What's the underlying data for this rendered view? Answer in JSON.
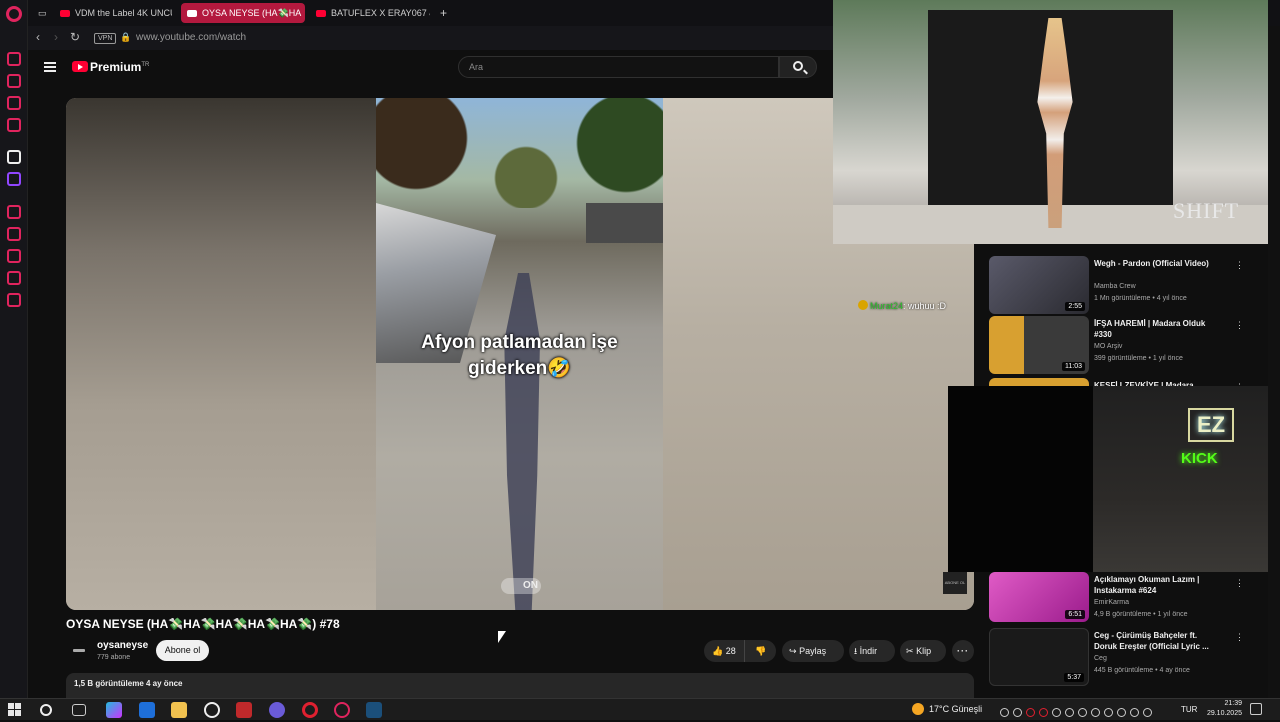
{
  "browser": {
    "tabs": [
      {
        "label": "VDM the Label 4K UNCUT"
      },
      {
        "label": "OYSA NEYSE (HA💸HA"
      },
      {
        "label": "BATUFLEX X ERAY067 &"
      }
    ],
    "vpn_label": "VPN",
    "url": "www.youtube.com/watch"
  },
  "youtube": {
    "brand": "Premium",
    "brand_sup": "TR",
    "search_placeholder": "Ara"
  },
  "video": {
    "caption": "Afyon patlamadan işe giderken🤣",
    "badge_text": "ON",
    "watermark": "ABONE OL",
    "title": "OYSA NEYSE (HA💸HA💸HA💸HA💸HA💸) #78",
    "channel": "oysaneyse",
    "subscribers": "779 abone",
    "subscribe_label": "Abone ol",
    "likes": "28",
    "share_label": "Paylaş",
    "download_label": "İndir",
    "clip_label": "Klip",
    "more_label": "···",
    "meta": "1,5 B görüntüleme  4 ay önce"
  },
  "chat": {
    "user": "Murat24",
    "message": ": wuhuu :D"
  },
  "recommendations": [
    {
      "title": "Wegh - Pardon (Official Video)",
      "channel": "Mamba Crew",
      "meta": "1 Mn görüntüleme • 4 yıl önce",
      "duration": "2:55",
      "thumb_color": "#3b3b48"
    },
    {
      "title": "İFŞA HAREMİ | Madara Olduk #330",
      "channel": "MO Arşiv",
      "meta": "399 görüntüleme • 1 yıl önce",
      "duration": "11:03",
      "thumb_color": "#2a2a24"
    },
    {
      "title": "KEŞFİ LZEVKİYE | Madara",
      "channel": "",
      "meta": "",
      "duration": "",
      "thumb_color": "#d8a030"
    },
    {
      "title": "Açıklamayı Okuman Lazım | Instakarma #624",
      "channel": "EmirKarma",
      "meta": "4,9 B görüntüleme • 1 yıl önce",
      "duration": "6:51",
      "thumb_color": "#d23fb6"
    },
    {
      "title": "Ceg - Çürümüş Bahçeler ft. Doruk Ereşter (Official Lyric ...",
      "channel": "Ceg",
      "meta": "445 B görüntüleme • 4 ay önce",
      "duration": "5:37",
      "thumb_color": "#1a1a1a"
    }
  ],
  "pip": {
    "runway_logo": "SHIFT",
    "stream_ez": "EZ",
    "stream_kick": "KICK"
  },
  "taskbar": {
    "weather": "17°C  Güneşli",
    "lang": "TUR",
    "time": "21:39",
    "date": "29.10.2025"
  }
}
